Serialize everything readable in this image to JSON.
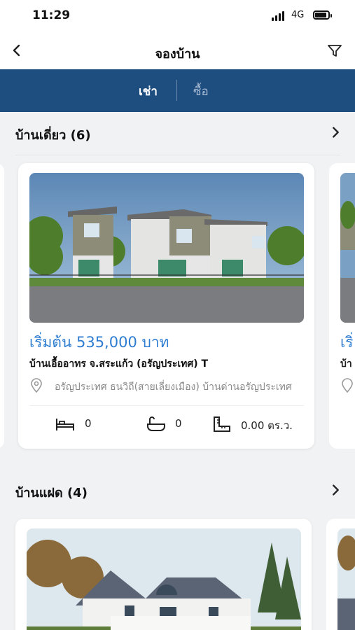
{
  "status": {
    "time": "11:29",
    "network": "4G"
  },
  "header": {
    "title": "จองบ้าน",
    "back_icon": "chevron-left-icon",
    "filter_icon": "filter-icon"
  },
  "tabs": [
    {
      "label": "เช่า",
      "active": true
    },
    {
      "label": "ซื้อ",
      "active": false
    }
  ],
  "sections": [
    {
      "title": "บ้านเดี่ยว (6)",
      "listings": [
        {
          "price": "เริ่มต้น 535,000 บาท",
          "name": "บ้านเอื้ออาทร จ.สระแก้ว (อรัญประเทศ) T",
          "location": "อรัญประเทศ ธนวิถี(สายเลี่ยงเมือง) บ้านด่านอรัญประเทศ",
          "bedrooms": "0",
          "bathrooms": "0",
          "area": "0.00 ตร.ว."
        }
      ],
      "peek_next": {
        "price": "เริ่",
        "name": "บ้า"
      }
    },
    {
      "title": "บ้านแฝด (4)"
    }
  ],
  "colors": {
    "primary": "#1e4d80",
    "price": "#2e7dd1"
  }
}
